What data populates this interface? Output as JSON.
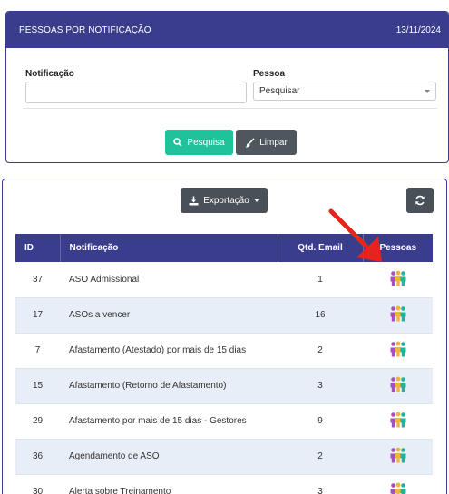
{
  "header": {
    "title": "PESSOAS POR NOTIFICAÇÃO",
    "date": "13/11/2024"
  },
  "filters": {
    "notificacao_label": "Notificação",
    "notificacao_value": "",
    "pessoa_label": "Pessoa",
    "pessoa_selected": "Pesquisar"
  },
  "buttons": {
    "search": "Pesquisa",
    "clear": "Limpar",
    "export": "Exportação"
  },
  "table": {
    "columns": [
      "ID",
      "Notificação",
      "Qtd. Email",
      "Pessoas"
    ],
    "rows": [
      {
        "id": "37",
        "notificacao": "ASO Admissional",
        "qtd": "1"
      },
      {
        "id": "17",
        "notificacao": "ASOs a vencer",
        "qtd": "16"
      },
      {
        "id": "7",
        "notificacao": "Afastamento (Atestado) por mais de 15 dias",
        "qtd": "2"
      },
      {
        "id": "15",
        "notificacao": "Afastamento (Retorno de Afastamento)",
        "qtd": "3"
      },
      {
        "id": "29",
        "notificacao": "Afastamento por mais de 15 dias - Gestores",
        "qtd": "9"
      },
      {
        "id": "36",
        "notificacao": "Agendamento de ASO",
        "qtd": "2"
      },
      {
        "id": "30",
        "notificacao": "Alerta sobre Treinamento",
        "qtd": "3"
      }
    ]
  },
  "colors": {
    "primary": "#3a3d8c",
    "success": "#1fc29a",
    "dark": "#4e565e",
    "row_alt": "#e8eef8",
    "arrow": "#e8231e"
  },
  "icons": {
    "people": "people-icon",
    "search": "search-icon",
    "clear": "brush-icon",
    "export": "download-icon",
    "refresh": "refresh-icon"
  }
}
